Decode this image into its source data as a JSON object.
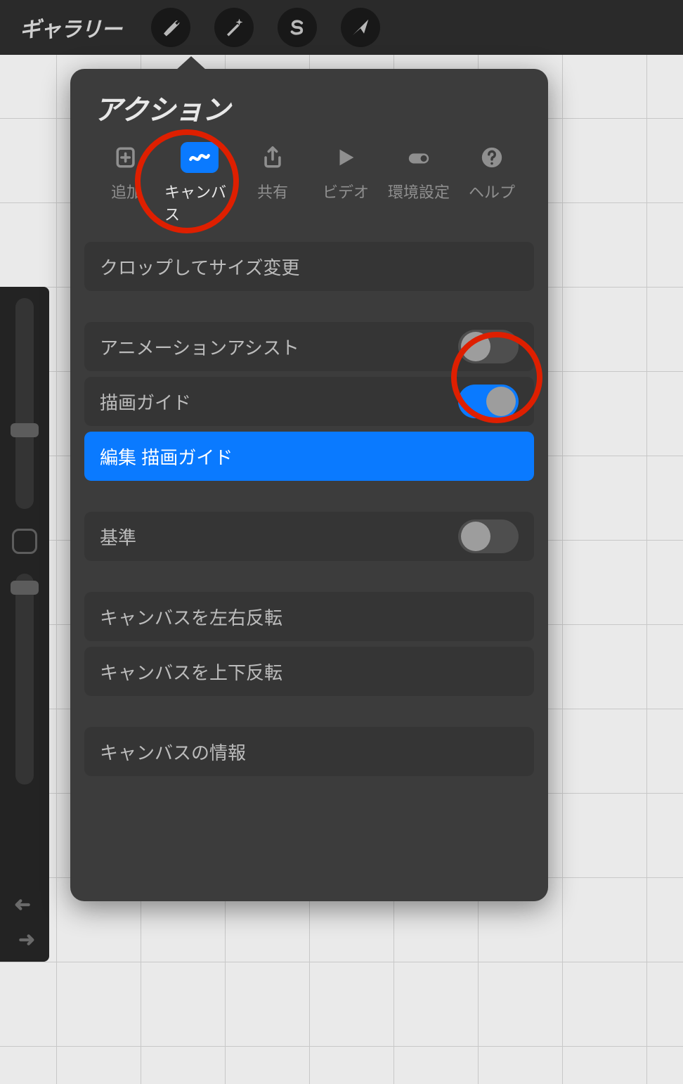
{
  "topbar": {
    "gallery": "ギャラリー"
  },
  "popover": {
    "title": "アクション",
    "tabs": {
      "add": "追加",
      "canvas": "キャンバス",
      "share": "共有",
      "video": "ビデオ",
      "prefs": "環境設定",
      "help": "ヘルプ"
    },
    "rows": {
      "crop": "クロップしてサイズ変更",
      "anim_assist": "アニメーションアシスト",
      "draw_guide": "描画ガイド",
      "edit_draw_guide": "編集 描画ガイド",
      "reference": "基準",
      "flip_h": "キャンバスを左右反転",
      "flip_v": "キャンバスを上下反転",
      "info": "キャンバスの情報"
    },
    "toggles": {
      "anim_assist": false,
      "draw_guide": true,
      "reference": false
    }
  }
}
